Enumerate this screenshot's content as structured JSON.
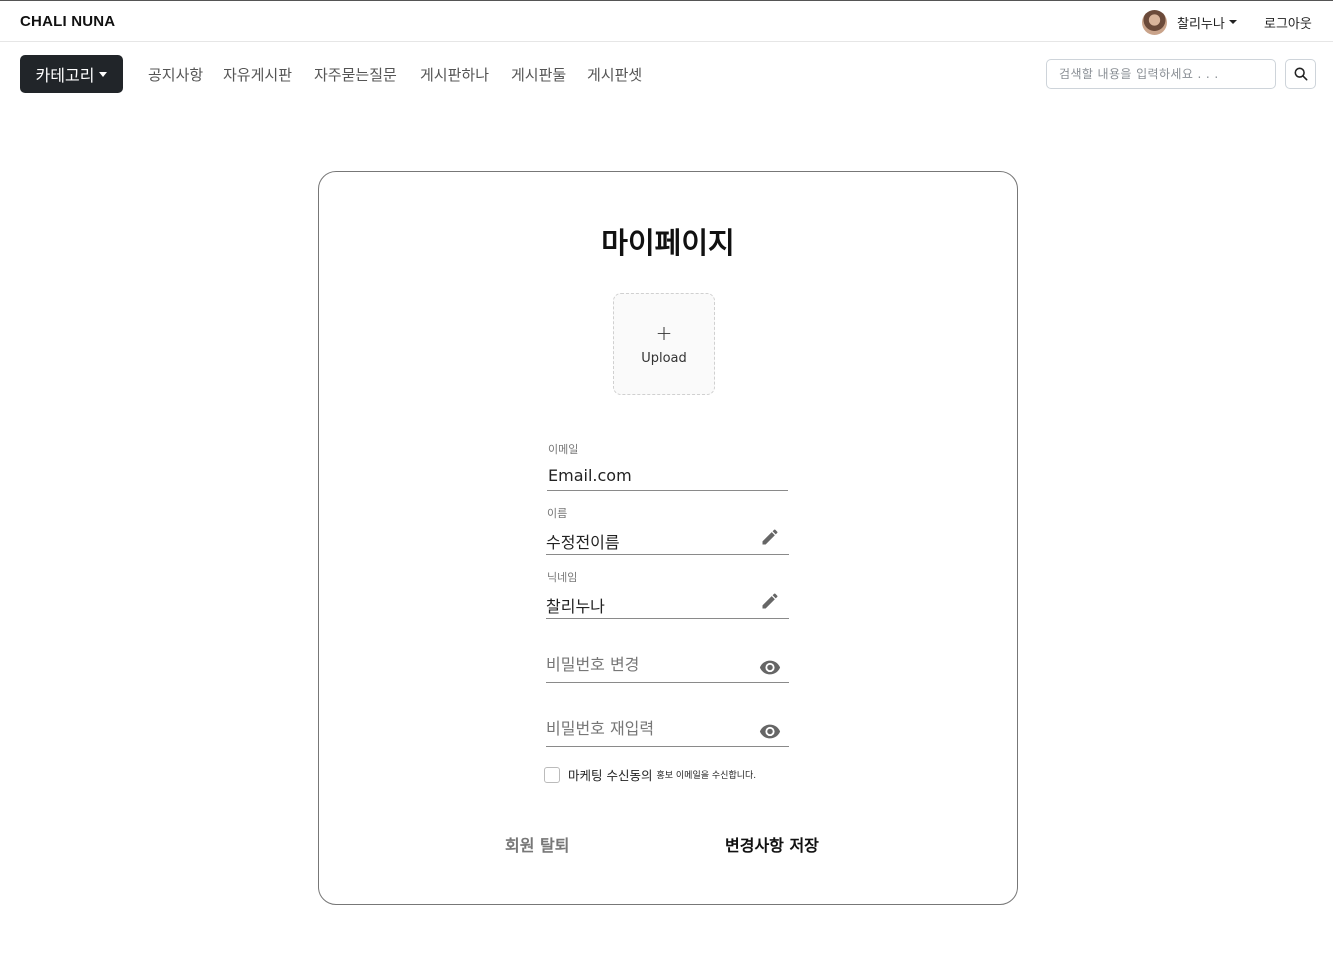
{
  "header": {
    "brand": "CHALI NUNA",
    "user_name": "찰리누나",
    "logout_label": "로그아웃"
  },
  "nav": {
    "category_label": "카테고리",
    "links": [
      "공지사항",
      "자유게시판",
      "자주묻는질문",
      "게시판하나",
      "게시판둘",
      "게시판셋"
    ],
    "search_placeholder": "검색할 내용을 입력하세요 . . ."
  },
  "mypage": {
    "title": "마이페이지",
    "upload_plus": "+",
    "upload_label": "Upload",
    "email": {
      "label": "이메일",
      "value": "Email.com"
    },
    "name": {
      "label": "이름",
      "value": "수정전이름"
    },
    "nickname": {
      "label": "닉네임",
      "value": "찰리누나"
    },
    "password": {
      "placeholder": "비밀번호 변경"
    },
    "password_confirm": {
      "placeholder": "비밀번호 재입력"
    },
    "consent_label": "마케팅 수신동의",
    "consent_note": "홍보 이메일을 수신합니다.",
    "withdraw_label": "회원 탈퇴",
    "save_label": "변경사항 저장"
  },
  "icons": {
    "search": "search-icon",
    "edit": "pencil-icon",
    "visibility": "eye-icon",
    "user_caret": "chevron-down-icon"
  }
}
